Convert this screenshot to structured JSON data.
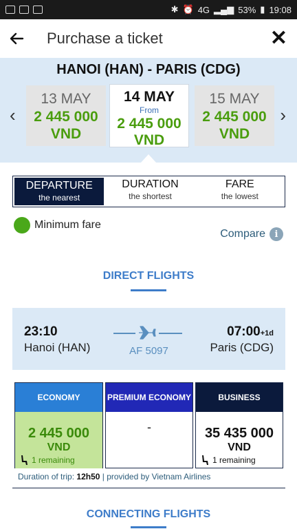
{
  "status": {
    "battery": "53%",
    "time": "19:08",
    "network": "4G"
  },
  "header": {
    "title": "Purchase a ticket"
  },
  "route": "HANOI (HAN) - PARIS (CDG)",
  "dates": [
    {
      "date": "13 MAY",
      "from": "",
      "price": "2 445 000",
      "currency": "VND"
    },
    {
      "date": "14 MAY",
      "from": "From",
      "price": "2 445 000",
      "currency": "VND"
    },
    {
      "date": "15 MAY",
      "from": "",
      "price": "2 445 000",
      "currency": "VND"
    }
  ],
  "sort": [
    {
      "label": "DEPARTURE",
      "sub": "the nearest"
    },
    {
      "label": "DURATION",
      "sub": "the shortest"
    },
    {
      "label": "FARE",
      "sub": "the lowest"
    }
  ],
  "legend": {
    "label": "Minimum fare",
    "color": "#4aa81a"
  },
  "compare": {
    "label": "Compare"
  },
  "sections": {
    "direct": "DIRECT FLIGHTS",
    "connecting": "CONNECTING FLIGHTS"
  },
  "flight": {
    "dep_time": "23:10",
    "dep_city": "Hanoi (HAN)",
    "arr_time": "07:00",
    "arr_offset": "+1d",
    "arr_city": "Paris (CDG)",
    "flight_no": "AF 5097"
  },
  "fares": {
    "economy": {
      "label": "ECONOMY",
      "price": "2 445 000",
      "currency": "VND",
      "remaining": "1 remaining"
    },
    "premium": {
      "label": "PREMIUM ECONOMY",
      "price": "-"
    },
    "business": {
      "label": "BUSINESS",
      "price": "35 435 000",
      "currency": "VND",
      "remaining": "1 remaining"
    }
  },
  "duration": {
    "label": "Duration of trip:",
    "value": "12h50",
    "provider": "| provided by Vietnam Airlines"
  },
  "colors": {
    "accent": "#3d7cc9",
    "navy": "#0b1a3c",
    "price_green": "#4a9d0e"
  }
}
